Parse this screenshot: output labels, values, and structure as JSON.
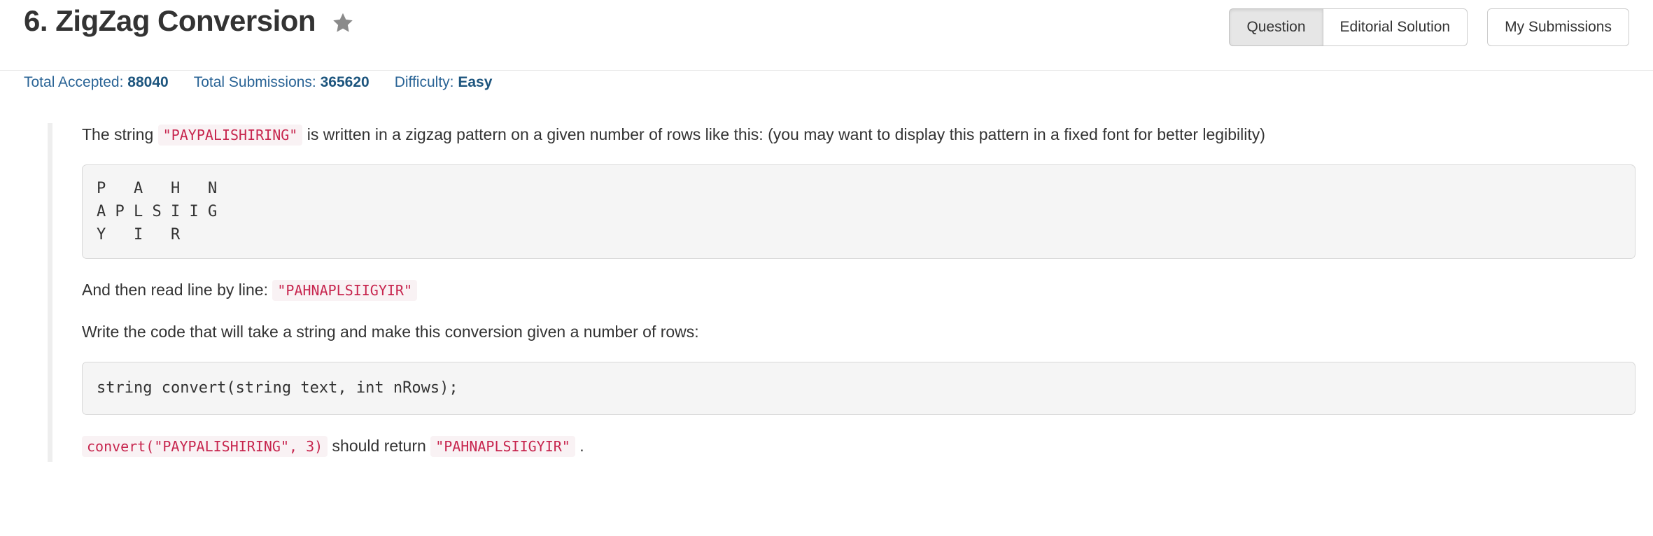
{
  "header": {
    "title": "6. ZigZag Conversion",
    "star_icon": "star-icon",
    "buttons": {
      "question": "Question",
      "editorial_solution": "Editorial Solution",
      "my_submissions": "My Submissions"
    },
    "active_button": "Question"
  },
  "stats": {
    "total_accepted_label": "Total Accepted:",
    "total_accepted_value": "88040",
    "total_submissions_label": "Total Submissions:",
    "total_submissions_value": "365620",
    "difficulty_label": "Difficulty:",
    "difficulty_value": "Easy"
  },
  "content": {
    "para1_a": "The string",
    "para1_code": "\"PAYPALISHIRING\"",
    "para1_b": "is written in a zigzag pattern on a given number of rows like this: (you may want to display this pattern in a fixed font for better legibility)",
    "zigzag_block": "P   A   H   N\nA P L S I I G\nY   I   R",
    "para2_a": "And then read line by line:",
    "para2_code": "\"PAHNAPLSIIGYIR\"",
    "para3": "Write the code that will take a string and make this conversion given a number of rows:",
    "signature_block": "string convert(string text, int nRows);",
    "para4_code1": "convert(\"PAYPALISHIRING\", 3)",
    "para4_mid": "should return",
    "para4_code2": "\"PAHNAPLSIIGYIR\"",
    "para4_end": "."
  },
  "colors": {
    "accent_link": "#2a6496",
    "inline_code_text": "#c7254e",
    "inline_code_bg": "#f9f2f4",
    "code_block_bg": "#f5f5f5",
    "star": "#888888"
  }
}
